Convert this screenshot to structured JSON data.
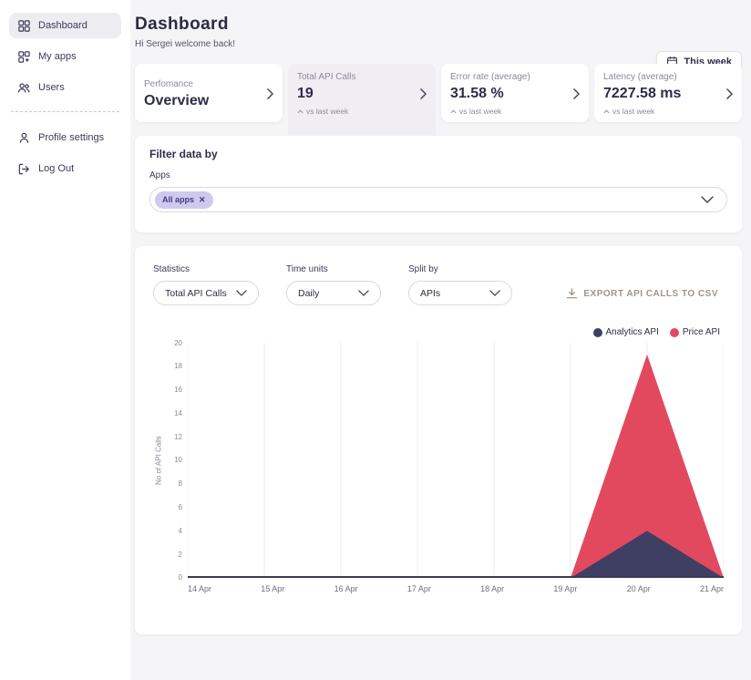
{
  "sidebar": {
    "items": [
      {
        "label": "Dashboard",
        "icon": "dashboard-icon",
        "active": true
      },
      {
        "label": "My apps",
        "icon": "apps-icon",
        "active": false
      },
      {
        "label": "Users",
        "icon": "users-icon",
        "active": false
      },
      {
        "label": "Profile settings",
        "icon": "profile-icon",
        "active": false
      },
      {
        "label": "Log Out",
        "icon": "logout-icon",
        "active": false
      }
    ]
  },
  "header": {
    "title": "Dashboard",
    "subtitle": "Hi Sergei welcome back!",
    "period_button": "This week"
  },
  "stat_cards": [
    {
      "label": "Perfomance",
      "value": "Overview",
      "note": ""
    },
    {
      "label": "Total API Calls",
      "value": "19",
      "note": "vs last week",
      "active": true
    },
    {
      "label": "Error rate (average)",
      "value": "31.58 %",
      "note": "vs last week"
    },
    {
      "label": "Latency (average)",
      "value": "7227.58 ms",
      "note": "vs last week"
    }
  ],
  "filter": {
    "title": "Filter data by",
    "field_label": "Apps",
    "chip": "All apps",
    "chip_close": "✕"
  },
  "controls": {
    "statistics_label": "Statistics",
    "statistics_value": "Total API Calls",
    "time_units_label": "Time units",
    "time_units_value": "Daily",
    "split_by_label": "Split by",
    "split_by_value": "APIs",
    "export_label": "EXPORT API CALLS TO CSV"
  },
  "chart_data": {
    "type": "area",
    "stacked": true,
    "x": [
      "14 Apr",
      "15 Apr",
      "16 Apr",
      "17 Apr",
      "18 Apr",
      "19 Apr",
      "20 Apr",
      "21 Apr"
    ],
    "series": [
      {
        "name": "Analytics API",
        "color": "#3f3f63",
        "values": [
          0,
          0,
          0,
          0,
          0,
          0,
          4,
          0
        ]
      },
      {
        "name": "Price API",
        "color": "#e2495f",
        "values": [
          0,
          0,
          0,
          0,
          0,
          0,
          15,
          0
        ]
      }
    ],
    "ylabel": "No of API Calls",
    "ylim": [
      0,
      20
    ],
    "ytick_step": 2,
    "legend_position": "top-right",
    "grid": "vertical",
    "colors": {
      "axis": "#3a3a55",
      "gridline": "#ebebf1"
    }
  }
}
